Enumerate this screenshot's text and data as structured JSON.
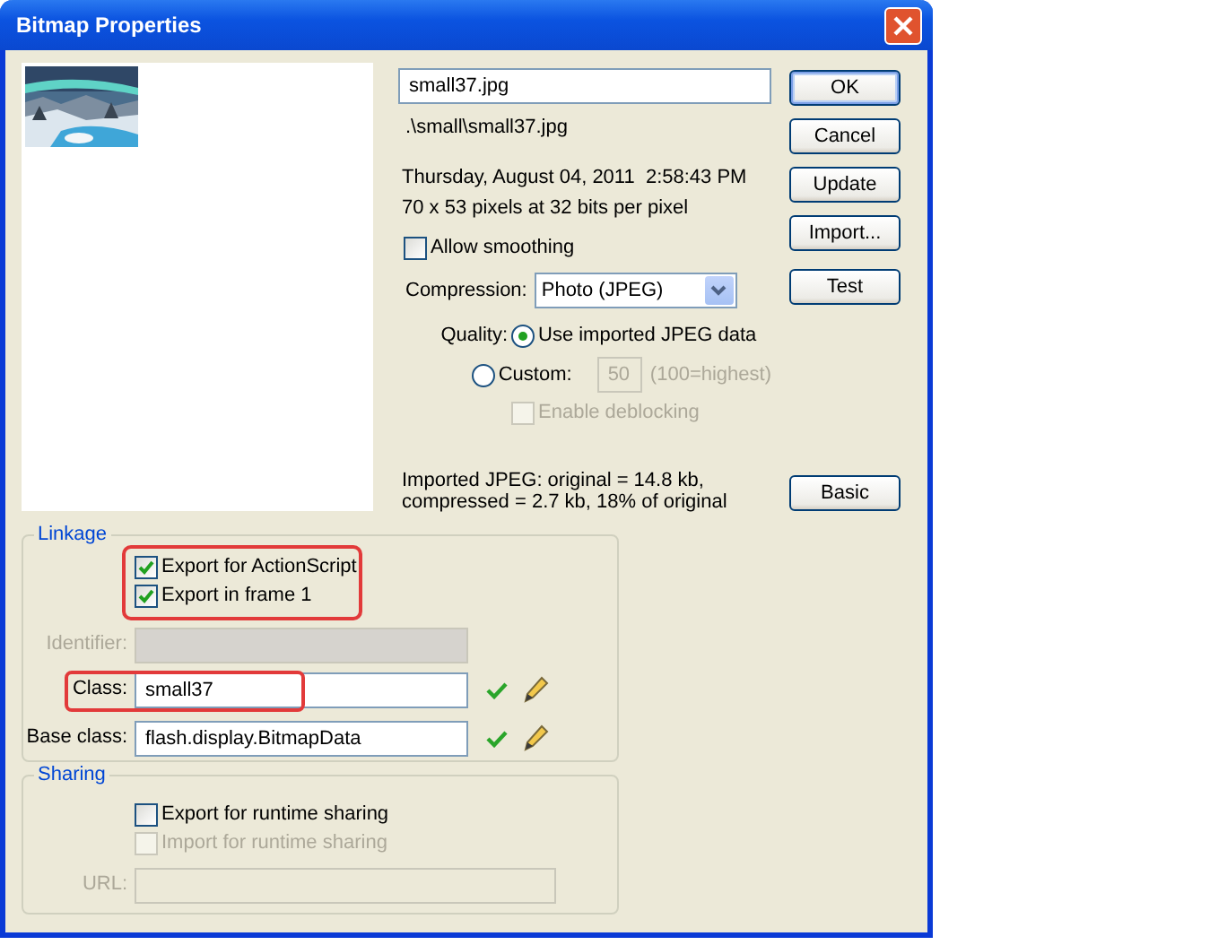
{
  "window": {
    "title": "Bitmap Properties"
  },
  "file_name": {
    "value": "small37.jpg"
  },
  "path": ".\\small\\small37.jpg",
  "date": "Thursday, August 04, 2011  2:58:43 PM",
  "dimensions": "70 x 53 pixels at 32 bits per pixel",
  "allow_smoothing": {
    "label": "Allow smoothing",
    "checked": false
  },
  "compression": {
    "label": "Compression:",
    "value": "Photo (JPEG)"
  },
  "quality": {
    "label": "Quality:",
    "options": [
      {
        "label": "Use imported JPEG data",
        "selected": true
      },
      {
        "label": "Custom:",
        "selected": false
      }
    ],
    "custom_value": "50",
    "custom_hint": "(100=highest)",
    "custom_disabled": true
  },
  "enable_deblocking": {
    "label": "Enable deblocking",
    "checked": false,
    "disabled": true
  },
  "import_info": [
    "Imported JPEG: original = 14.8 kb,",
    "compressed = 2.7 kb, 18% of original"
  ],
  "buttons": [
    {
      "label": "OK",
      "default": true
    },
    {
      "label": "Cancel",
      "default": false
    },
    {
      "label": "Update",
      "default": false
    },
    {
      "label": "Import...",
      "default": false
    },
    {
      "label": "Test",
      "default": false
    }
  ],
  "basic_button": "Basic",
  "linkage": {
    "title": "Linkage",
    "checkboxes_highlighted": true,
    "checkboxes": [
      {
        "label": "Export for ActionScript",
        "checked": true,
        "disabled": false
      },
      {
        "label": "Export in frame 1",
        "checked": true,
        "disabled": false
      }
    ],
    "fields": [
      {
        "label": "Identifier:",
        "disabled": true,
        "highlighted": false,
        "tools": false
      },
      {
        "label": "Class:",
        "value": "small37",
        "disabled": false,
        "highlighted": true,
        "tools": true
      },
      {
        "label": "Base class:",
        "value": "flash.display.BitmapData",
        "disabled": false,
        "highlighted": false,
        "tools": true
      }
    ]
  },
  "sharing": {
    "title": "Sharing",
    "checkboxes": [
      {
        "label": "Export for runtime sharing",
        "checked": false,
        "disabled": false
      },
      {
        "label": "Import for runtime sharing",
        "checked": false,
        "disabled": true
      }
    ],
    "url": {
      "label": "URL:",
      "disabled": true
    }
  }
}
